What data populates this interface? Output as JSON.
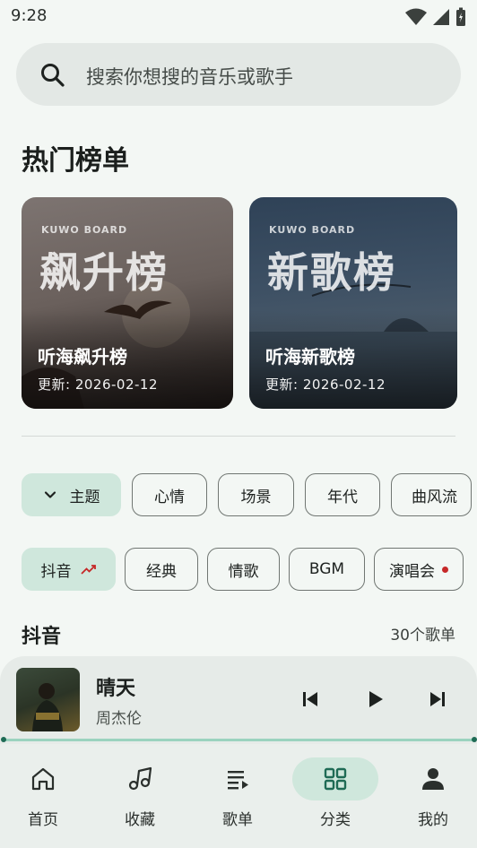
{
  "status_bar": {
    "time": "9:28"
  },
  "search": {
    "placeholder": "搜索你想搜的音乐或歌手"
  },
  "hot_charts": {
    "title": "热门榜单",
    "cards": [
      {
        "brand": "KUWO BOARD",
        "big_text": "飙升榜",
        "name": "听海飙升榜",
        "date": "更新: 2026-02-12"
      },
      {
        "brand": "KUWO BOARD",
        "big_text": "新歌榜",
        "name": "听海新歌榜",
        "date": "更新: 2026-02-12"
      }
    ]
  },
  "filter_row1": {
    "theme_chip": "主题",
    "chips": [
      "心情",
      "场景",
      "年代",
      "曲风流"
    ]
  },
  "filter_row2": {
    "active_chip": "抖音",
    "chips": [
      "经典",
      "情歌",
      "BGM",
      "演唱会"
    ]
  },
  "list": {
    "title": "抖音",
    "count": "30个歌单"
  },
  "player": {
    "title": "晴天",
    "artist": "周杰伦",
    "progress": 0.0
  },
  "nav": {
    "items": [
      {
        "label": "首页",
        "icon": "home-icon"
      },
      {
        "label": "收藏",
        "icon": "music-note-icon"
      },
      {
        "label": "歌单",
        "icon": "playlist-icon"
      },
      {
        "label": "分类",
        "icon": "grid-icon"
      },
      {
        "label": "我的",
        "icon": "person-icon"
      }
    ],
    "active_index": 3
  },
  "colors": {
    "accent": "#1f6b55",
    "chip_active": "#cfe7dc",
    "background": "#f3f7f4",
    "trend_red": "#c62828"
  }
}
